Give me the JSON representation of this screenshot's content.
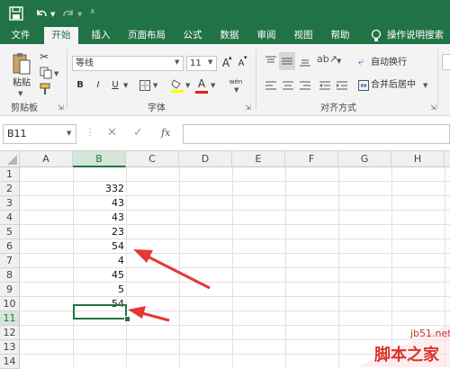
{
  "quick_access": {
    "save_icon": "save-icon",
    "undo_icon": "undo-icon",
    "redo_icon": "redo-icon"
  },
  "tabs": [
    "文件",
    "开始",
    "插入",
    "页面布局",
    "公式",
    "数据",
    "审阅",
    "视图",
    "帮助"
  ],
  "active_tab": "开始",
  "tell_me": "操作说明搜索",
  "ribbon": {
    "paste_label": "粘贴",
    "clipboard_group": "剪贴板",
    "font_name": "等线",
    "font_size": "11",
    "grow_font": "A",
    "shrink_font": "A",
    "bold": "B",
    "italic": "I",
    "underline": "U",
    "font_color_letter": "A",
    "phonetic": "wén",
    "font_group": "字体",
    "wrap_text": "自动换行",
    "merge_center": "合并后居中",
    "align_group": "对齐方式"
  },
  "formula_bar": {
    "name_box": "B11",
    "fx": "fx",
    "formula": ""
  },
  "columns": [
    "A",
    "B",
    "C",
    "D",
    "E",
    "F",
    "G",
    "H"
  ],
  "selected_column": "B",
  "rows": [
    "1",
    "2",
    "3",
    "4",
    "5",
    "6",
    "7",
    "8",
    "9",
    "10",
    "11",
    "12",
    "13",
    "14"
  ],
  "selected_row": "11",
  "column_b_values": [
    "",
    "332",
    "43",
    "43",
    "23",
    "54",
    "4",
    "45",
    "5",
    "54",
    "",
    "",
    "",
    ""
  ],
  "active_cell": "B11",
  "watermark": {
    "line1": "jb51.net",
    "line2": "脚本之家"
  },
  "colors": {
    "excel_green": "#217346",
    "arrow_red": "#e53935"
  }
}
